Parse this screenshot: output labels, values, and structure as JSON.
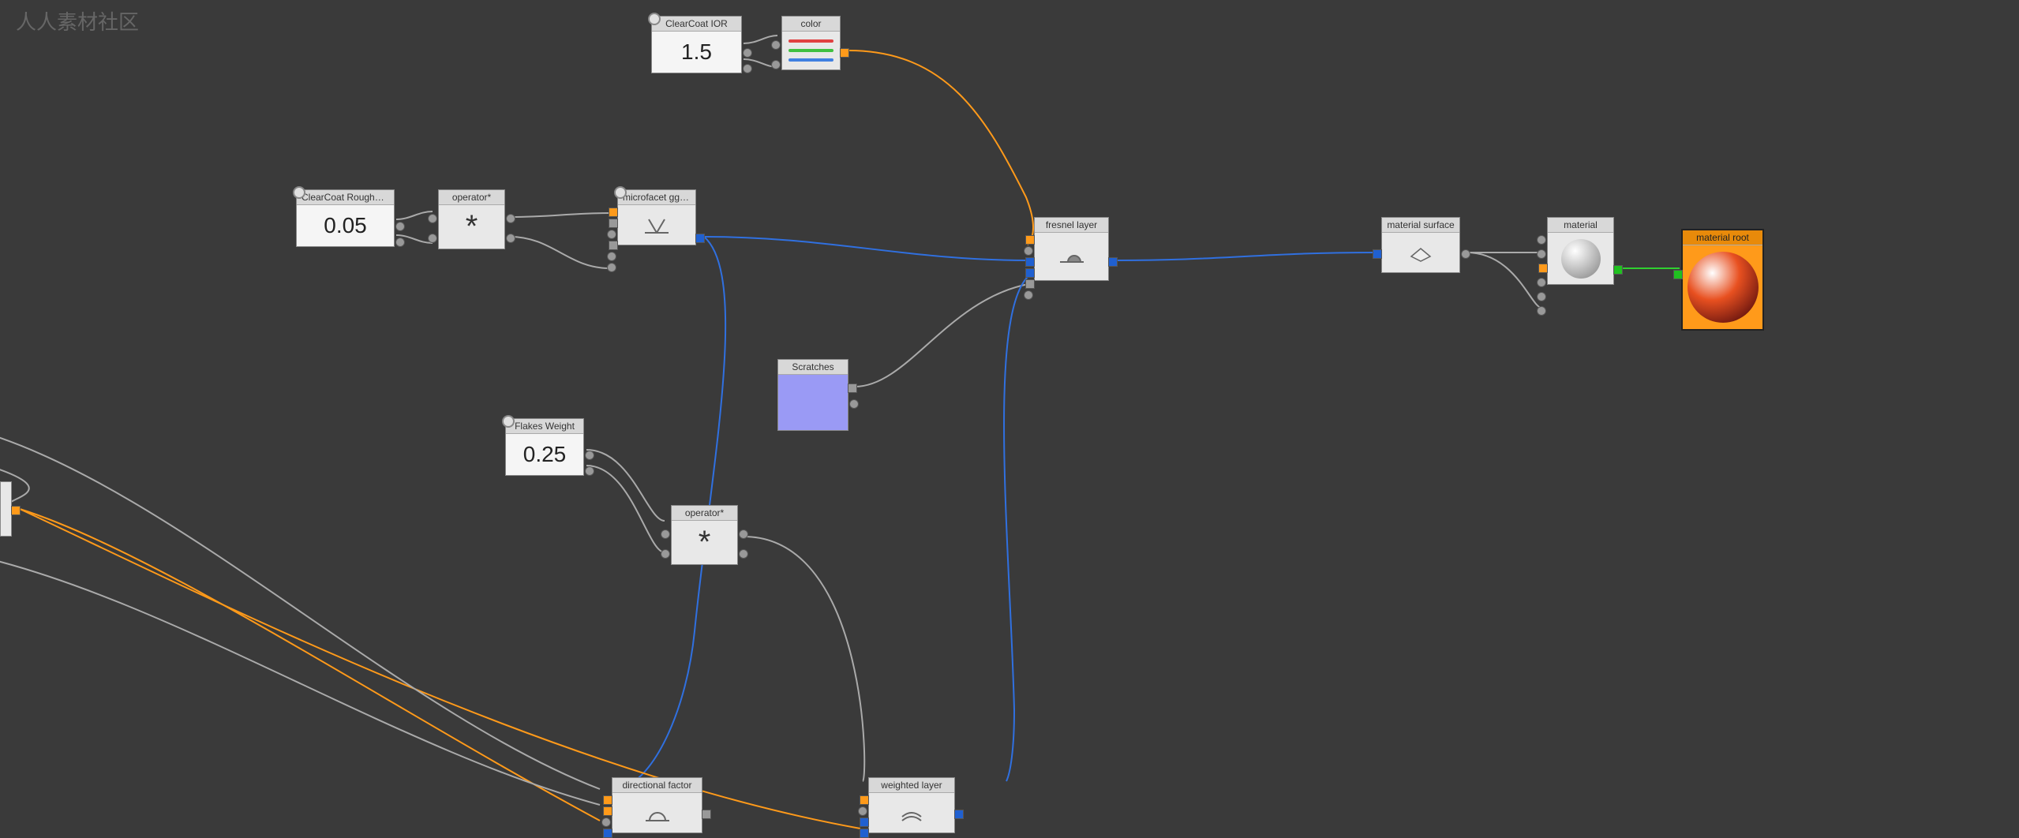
{
  "watermark": "人人素材社区",
  "nodes": {
    "clearcoat_ior": {
      "title": "ClearCoat IOR",
      "value": "1.5"
    },
    "color": {
      "title": "color"
    },
    "clearcoat_roughness": {
      "title": "ClearCoat Roughn…",
      "value": "0.05"
    },
    "operator1": {
      "title": "operator*",
      "symbol": "*"
    },
    "microfacet": {
      "title": "microfacet ggx sm…"
    },
    "fresnel_layer": {
      "title": "fresnel layer"
    },
    "material_surface": {
      "title": "material surface"
    },
    "material": {
      "title": "material"
    },
    "material_root": {
      "title": "material root"
    },
    "scratches": {
      "title": "Scratches"
    },
    "flakes_weight": {
      "title": "Flakes Weight",
      "value": "0.25"
    },
    "operator2": {
      "title": "operator*",
      "symbol": "*"
    },
    "directional_factor": {
      "title": "directional factor"
    },
    "weighted_layer": {
      "title": "weighted layer"
    }
  }
}
